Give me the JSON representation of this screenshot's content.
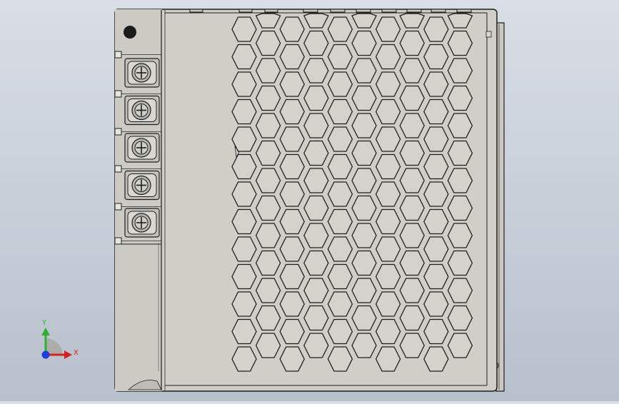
{
  "viewport": {
    "background_top": "#d9dee6",
    "background_bottom": "#b8c0cc"
  },
  "model": {
    "part": "power-supply-enclosure",
    "body_color": "#cfcfc8",
    "edge_color": "#1e1e1e",
    "terminal_count": 5,
    "vent_pattern": "hexagonal"
  },
  "triad": {
    "y_label": "Y",
    "x_label": "X",
    "y_color": "#2fae2f",
    "x_color": "#d22222",
    "z_color": "#1f3fd8"
  }
}
